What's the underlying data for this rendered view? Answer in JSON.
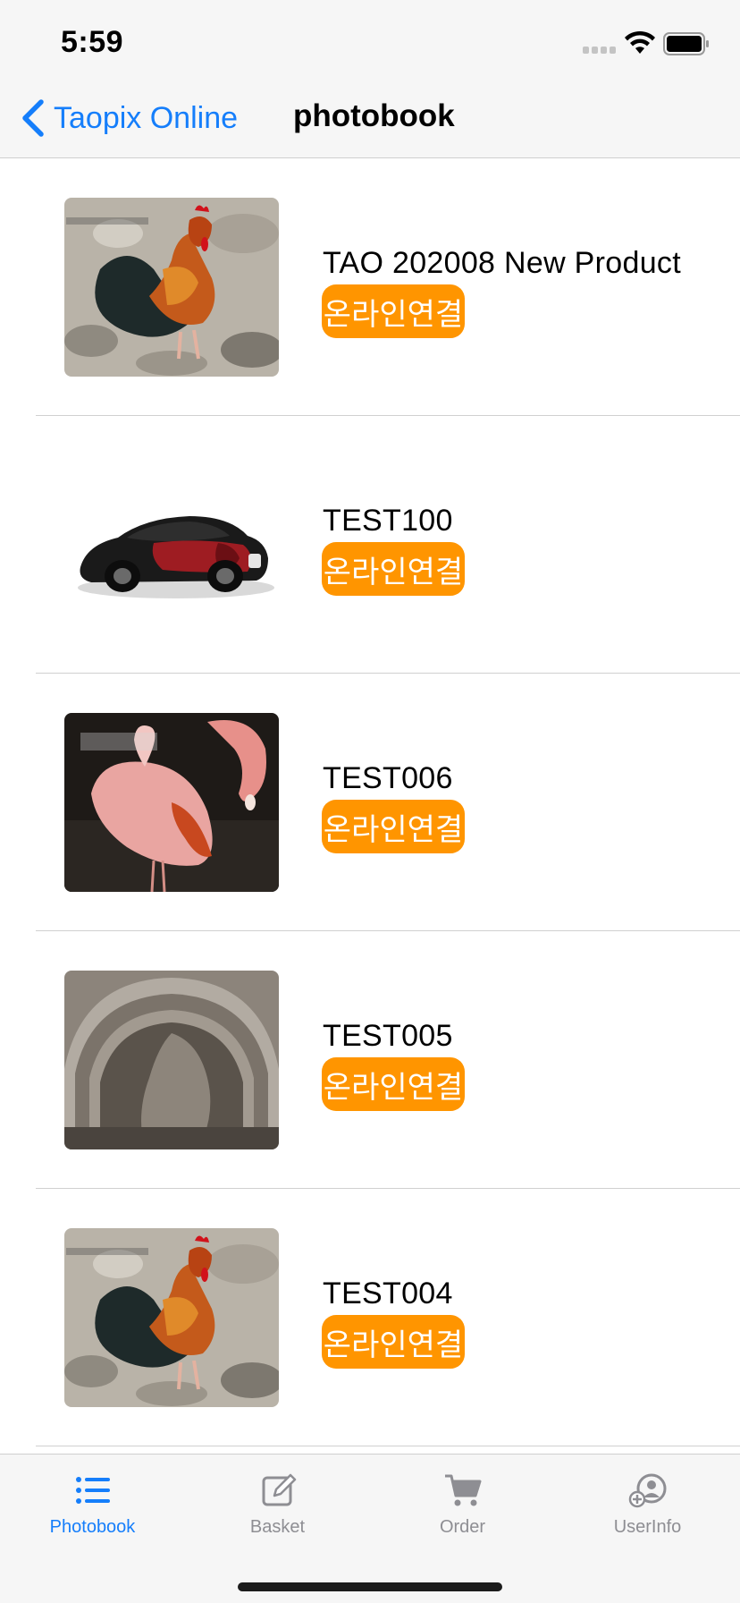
{
  "status_bar": {
    "time": "5:59"
  },
  "nav": {
    "back_label": "Taopix Online",
    "title": "photobook"
  },
  "products": [
    {
      "title": "TAO 202008 New Product",
      "badge": "온라인연결",
      "thumbnail": "rooster-image"
    },
    {
      "title": "TEST100",
      "badge": "온라인연결",
      "thumbnail": "sports-car-image"
    },
    {
      "title": "TEST006",
      "badge": "온라인연결",
      "thumbnail": "flamingo-image"
    },
    {
      "title": "TEST005",
      "badge": "온라인연결",
      "thumbnail": "stone-arch-image"
    },
    {
      "title": "TEST004",
      "badge": "온라인연결",
      "thumbnail": "rooster-image"
    }
  ],
  "tabs": [
    {
      "label": "Photobook",
      "icon": "list-icon",
      "active": true
    },
    {
      "label": "Basket",
      "icon": "edit-icon",
      "active": false
    },
    {
      "label": "Order",
      "icon": "cart-icon",
      "active": false
    },
    {
      "label": "UserInfo",
      "icon": "add-user-icon",
      "active": false
    }
  ],
  "colors": {
    "accent": "#157efb",
    "badge": "#ff9500",
    "inactive": "#8e8e93"
  }
}
